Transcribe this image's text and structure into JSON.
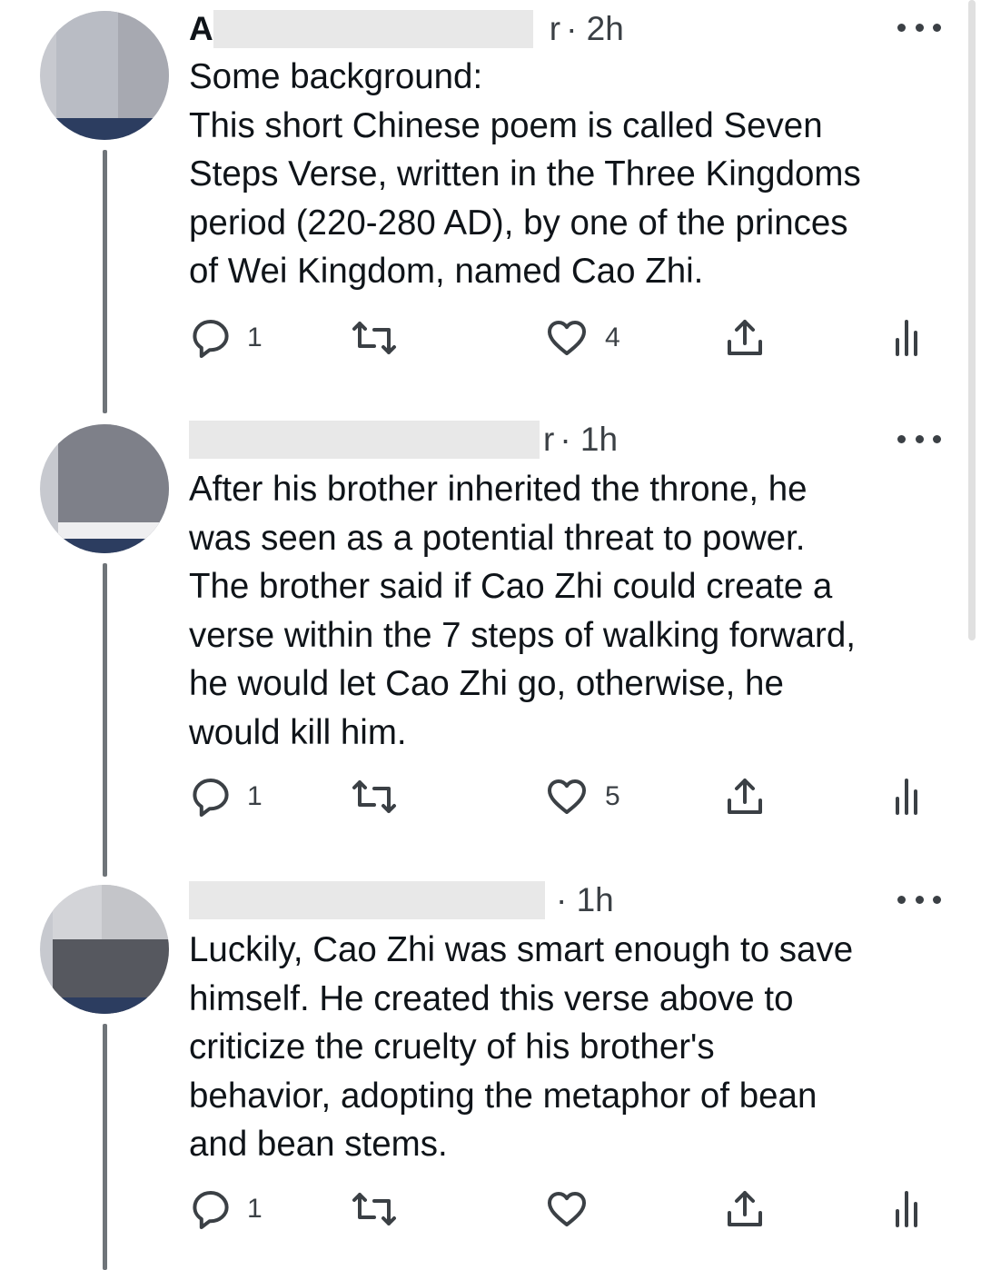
{
  "tweets": [
    {
      "name_fragment": "A",
      "handle_tail": "r",
      "time": "· 2h",
      "text": "Some background:\nThis short Chinese poem is called Seven\nSteps Verse, written in the Three Kingdoms\nperiod (220-280 AD), by one of the princes\nof Wei Kingdom, named Cao Zhi.",
      "reply_count": "1",
      "retweet_count": "",
      "like_count": "4"
    },
    {
      "name_fragment": "",
      "handle_tail": "r",
      "time": "· 1h",
      "text": "After his brother inherited the throne, he\nwas seen as a potential threat to power.\nThe brother said if Cao Zhi could create a\nverse within the 7 steps of walking forward,\nhe would let Cao Zhi go, otherwise, he\nwould kill him.",
      "reply_count": "1",
      "retweet_count": "",
      "like_count": "5"
    },
    {
      "name_fragment": "",
      "handle_tail": "",
      "time": "· 1h",
      "text": "Luckily, Cao Zhi was smart enough to save\nhimself. He created this verse above to\ncriticize the cruelty of his brother's\nbehavior, adopting the metaphor of bean\nand bean stems.",
      "reply_count": "1",
      "retweet_count": "",
      "like_count": ""
    }
  ],
  "icons": {
    "reply": "reply-icon",
    "retweet": "retweet-icon",
    "like": "heart-icon",
    "share": "share-icon",
    "analytics": "analytics-icon",
    "more": "more-icon"
  },
  "colors": {
    "text": "#0f1419",
    "secondary": "#3b4045",
    "thread_line": "#6f7479",
    "redaction": "#e8e8e8"
  }
}
